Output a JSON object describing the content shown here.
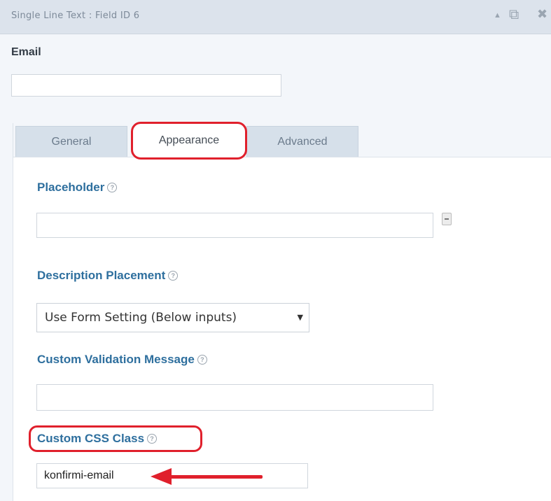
{
  "header": {
    "title": "Single Line Text : Field ID 6",
    "icons": [
      "collapse-arrow-icon",
      "duplicate-icon",
      "close-icon"
    ],
    "icon_glyphs": {
      "up": "▲",
      "dup": "⧉",
      "close": "✖"
    }
  },
  "field": {
    "label": "Email",
    "preview_value": ""
  },
  "tabs": [
    {
      "label": "General",
      "active": false
    },
    {
      "label": "Appearance",
      "active": true
    },
    {
      "label": "Advanced",
      "active": false
    }
  ],
  "settings": {
    "placeholder": {
      "label": "Placeholder",
      "value": ""
    },
    "description_placement": {
      "label": "Description Placement",
      "selected": "Use Form Setting (Below inputs)"
    },
    "custom_validation_message": {
      "label": "Custom Validation Message",
      "value": ""
    },
    "custom_css_class": {
      "label": "Custom CSS Class",
      "value": "konfirmi-email"
    }
  },
  "help_glyph": "?",
  "colors": {
    "accent_label": "#2e6f9e",
    "highlight": "#e0202c",
    "header_bg": "#dce3ec",
    "tab_bg": "#d6e0ea"
  }
}
